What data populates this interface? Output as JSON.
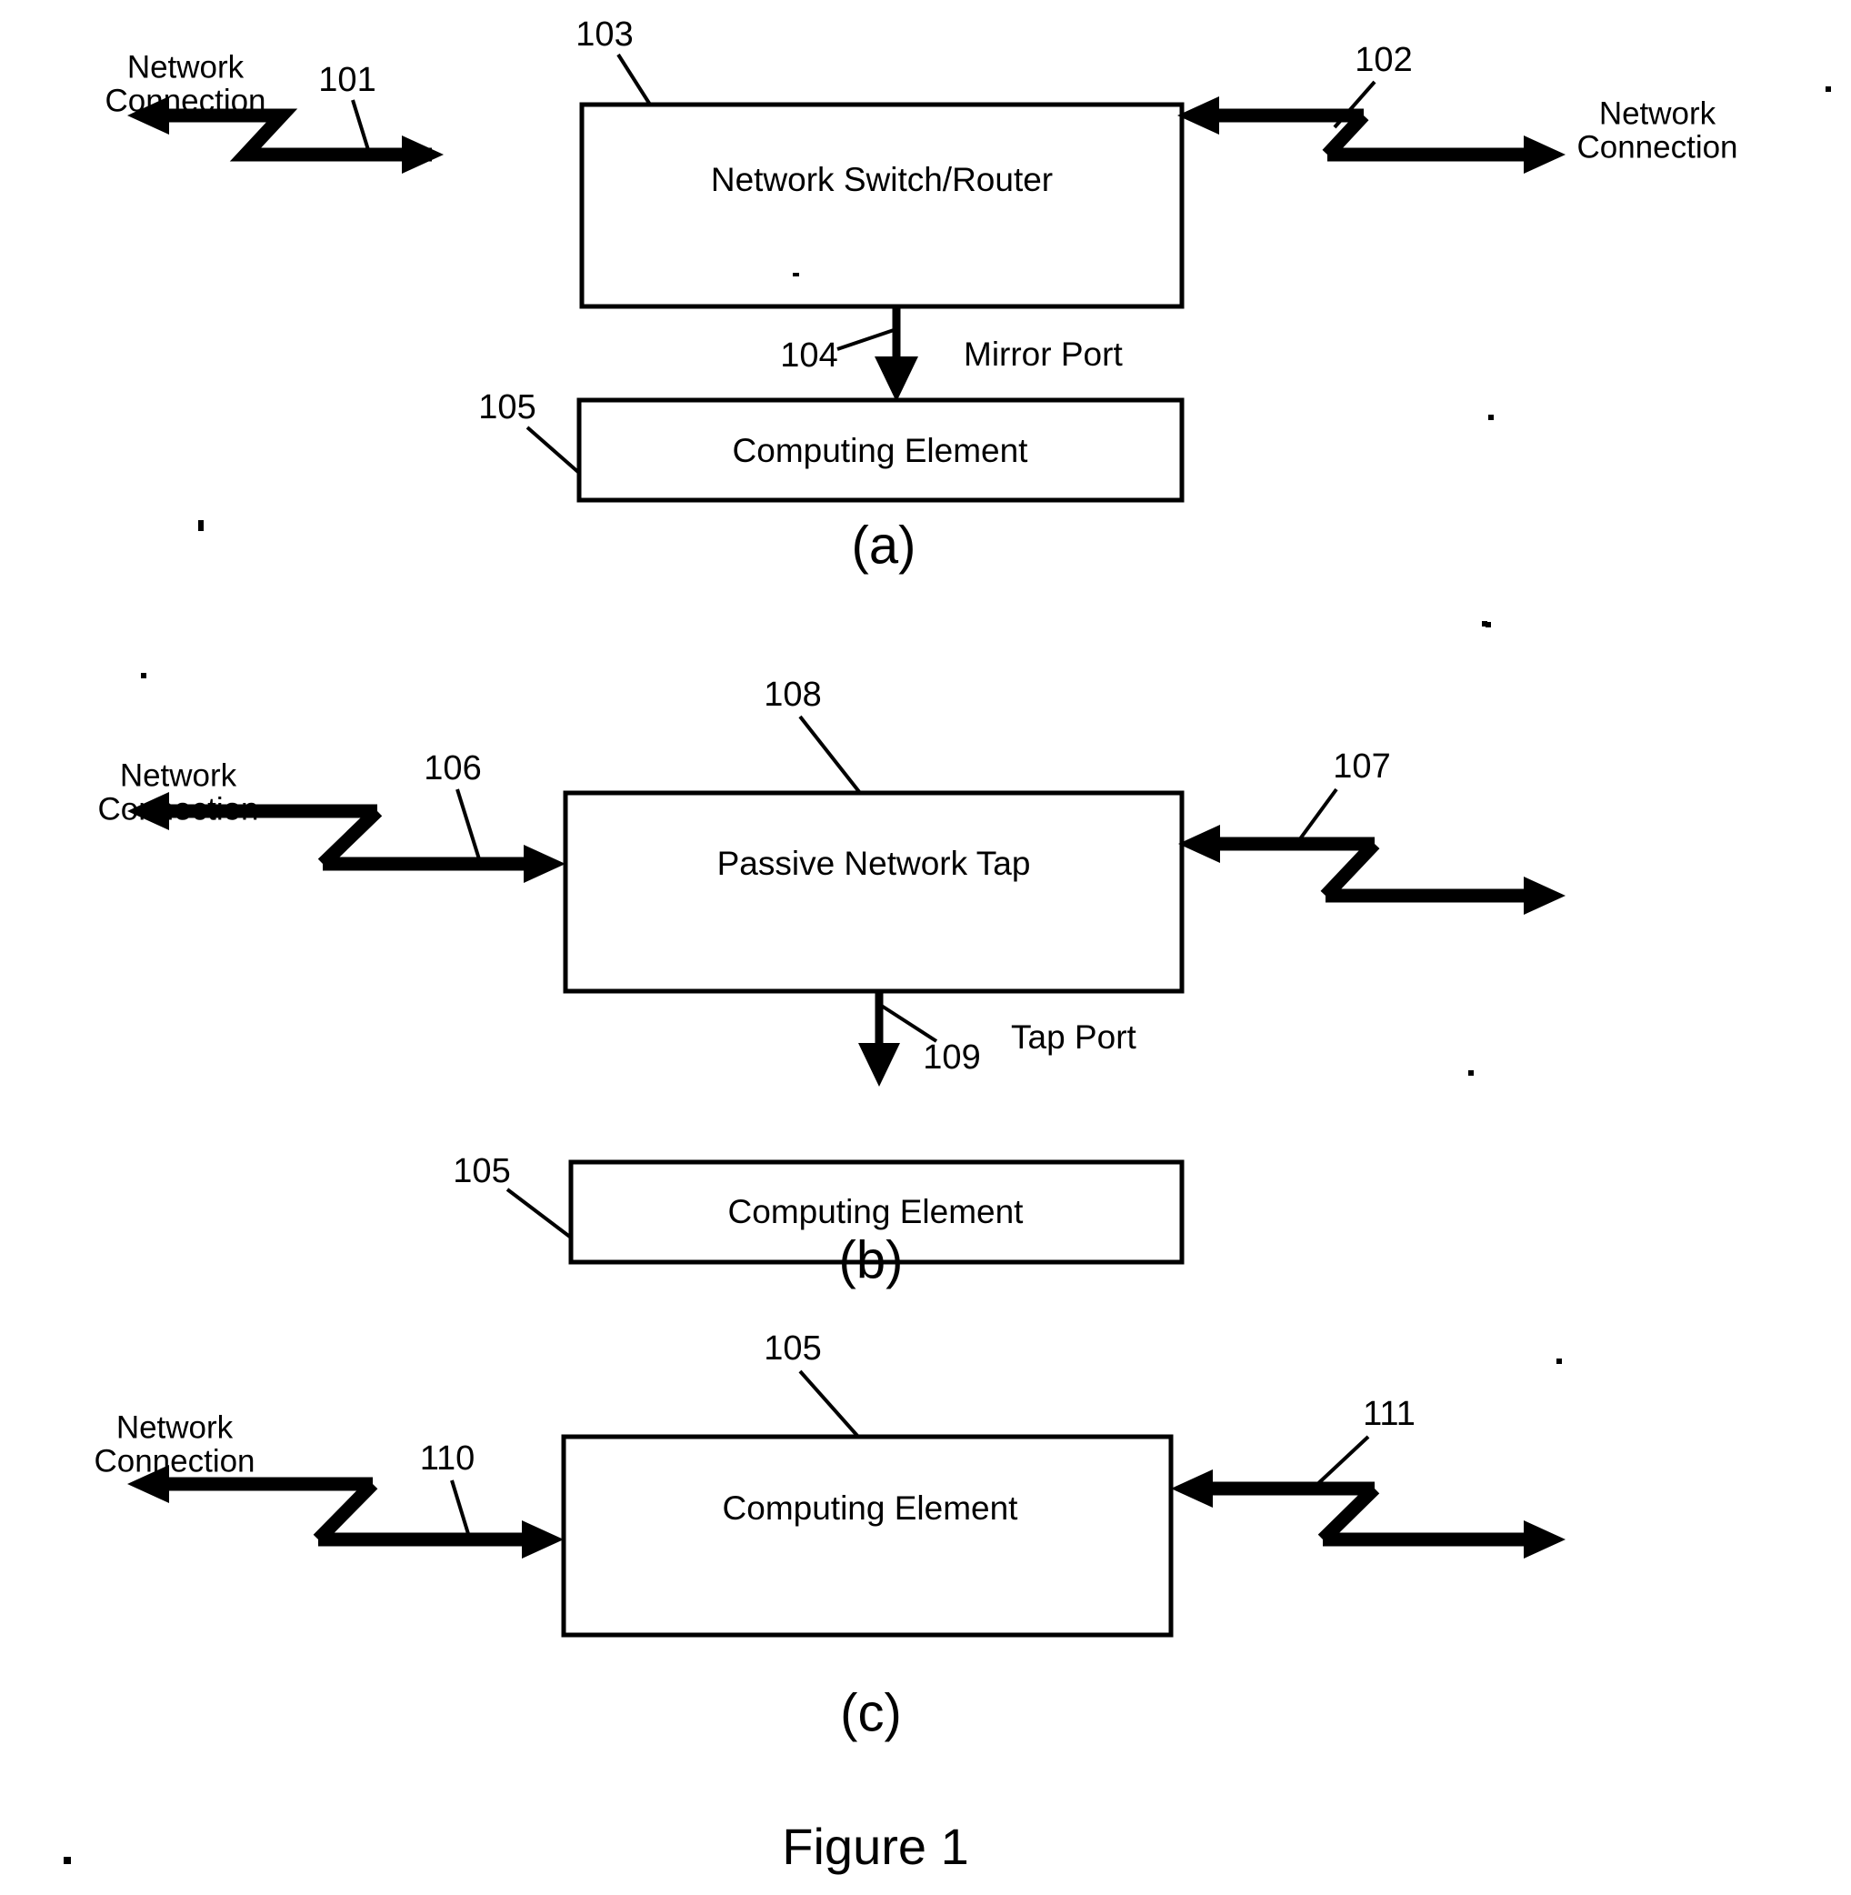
{
  "figure": {
    "caption": "Figure 1",
    "panels": [
      {
        "id": "a",
        "subcaption": "(a)",
        "main_box_label": "Network Switch/Router",
        "main_box_ref": "103",
        "lower_box_label": "Computing Element",
        "lower_box_ref": "105",
        "port_label": "Mirror Port",
        "port_ref": "104",
        "left_connection_ref": "101",
        "right_connection_ref": "102",
        "left_connection_label": "Network\nConnection",
        "left_connection_label_line1": "Network",
        "left_connection_label_line2": "Connection",
        "right_connection_label_line1": "Network",
        "right_connection_label_line2": "Connection"
      },
      {
        "id": "b",
        "subcaption": "(b)",
        "main_box_label": "Passive Network Tap",
        "main_box_ref": "108",
        "lower_box_label": "Computing Element",
        "lower_box_ref": "105",
        "port_label": "Tap Port",
        "port_ref": "109",
        "left_connection_ref": "106",
        "right_connection_ref": "107",
        "left_connection_label_line1": "Network",
        "left_connection_label_line2": "Connection",
        "right_connection_label_line1": "",
        "right_connection_label_line2": ""
      },
      {
        "id": "c",
        "subcaption": "(c)",
        "main_box_label": "Computing Element",
        "main_box_ref": "105",
        "lower_box_label": "",
        "lower_box_ref": "",
        "port_label": "",
        "port_ref": "",
        "left_connection_ref": "110",
        "right_connection_ref": "111",
        "left_connection_label_line1": "Network",
        "left_connection_label_line2": "Connection",
        "right_connection_label_line1": "",
        "right_connection_label_line2": ""
      }
    ]
  },
  "colors": {
    "ink": "#000000",
    "paper": "#ffffff"
  }
}
